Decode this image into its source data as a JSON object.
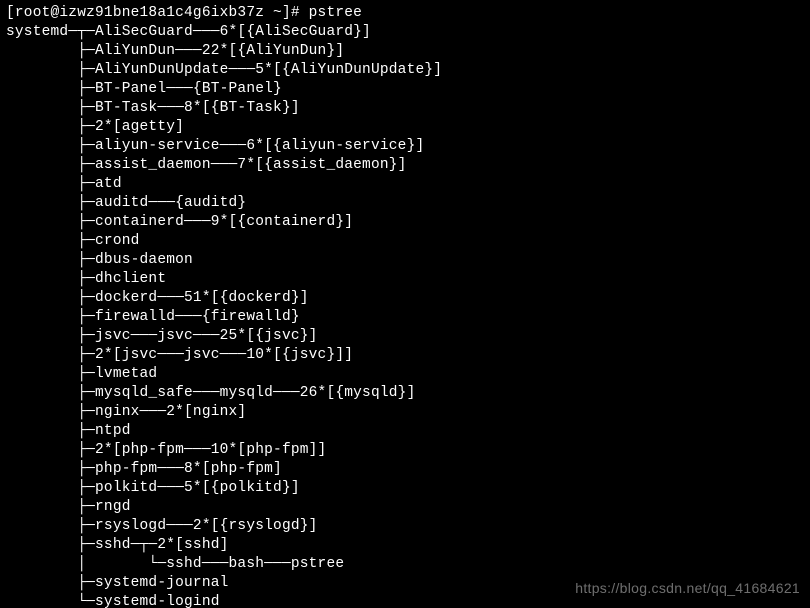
{
  "prompt": "[root@izwz91bne18a1c4g6ixb37z ~]# pstree",
  "root": "systemd",
  "children": [
    {
      "text": "AliSecGuard───6*[{AliSecGuard}]"
    },
    {
      "text": "AliYunDun───22*[{AliYunDun}]"
    },
    {
      "text": "AliYunDunUpdate───5*[{AliYunDunUpdate}]"
    },
    {
      "text": "BT-Panel───{BT-Panel}"
    },
    {
      "text": "BT-Task───8*[{BT-Task}]"
    },
    {
      "text": "2*[agetty]"
    },
    {
      "text": "aliyun-service───6*[{aliyun-service}]"
    },
    {
      "text": "assist_daemon───7*[{assist_daemon}]"
    },
    {
      "text": "atd"
    },
    {
      "text": "auditd───{auditd}"
    },
    {
      "text": "containerd───9*[{containerd}]"
    },
    {
      "text": "crond"
    },
    {
      "text": "dbus-daemon"
    },
    {
      "text": "dhclient"
    },
    {
      "text": "dockerd───51*[{dockerd}]"
    },
    {
      "text": "firewalld───{firewalld}"
    },
    {
      "text": "jsvc───jsvc───25*[{jsvc}]"
    },
    {
      "text": "2*[jsvc───jsvc───10*[{jsvc}]]"
    },
    {
      "text": "lvmetad"
    },
    {
      "text": "mysqld_safe───mysqld───26*[{mysqld}]"
    },
    {
      "text": "nginx───2*[nginx]"
    },
    {
      "text": "ntpd"
    },
    {
      "text": "2*[php-fpm───10*[php-fpm]]"
    },
    {
      "text": "php-fpm───8*[php-fpm]"
    },
    {
      "text": "polkitd───5*[{polkitd}]"
    },
    {
      "text": "rngd"
    },
    {
      "text": "rsyslogd───2*[{rsyslogd}]"
    },
    {
      "text": "sshd─┬─2*[sshd]",
      "sub": "     └─sshd───bash───pstree"
    },
    {
      "text": "systemd-journal"
    },
    {
      "text": "systemd-logind"
    }
  ],
  "watermark": "https://blog.csdn.net/qq_41684621"
}
